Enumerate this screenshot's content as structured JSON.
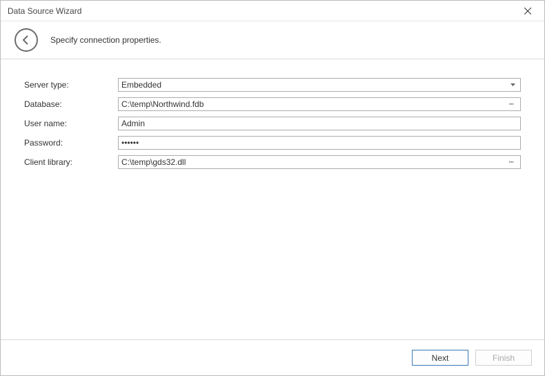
{
  "window": {
    "title": "Data Source Wizard"
  },
  "header": {
    "subtitle": "Specify connection properties."
  },
  "form": {
    "server_type": {
      "label": "Server type:",
      "value": "Embedded"
    },
    "database": {
      "label": "Database:",
      "value": "C:\\temp\\Northwind.fdb"
    },
    "user_name": {
      "label": "User name:",
      "value": "Admin"
    },
    "password": {
      "label": "Password:",
      "value": "••••••"
    },
    "client_lib": {
      "label": "Client library:",
      "value": "C:\\temp\\gds32.dll"
    }
  },
  "footer": {
    "next": "Next",
    "finish": "Finish"
  }
}
